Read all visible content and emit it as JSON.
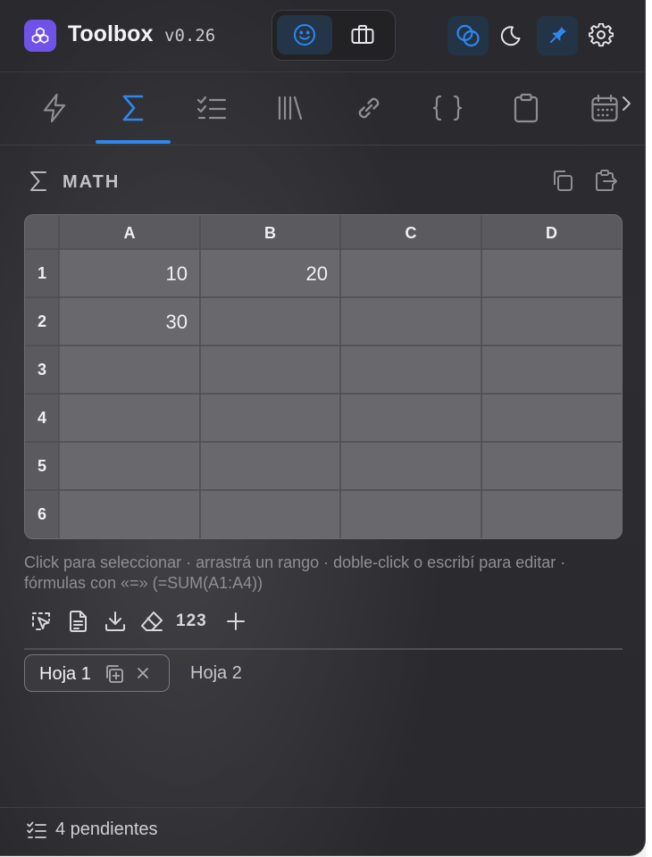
{
  "header": {
    "title": "Toolbox",
    "version": "v0.26",
    "mode_buttons": [
      {
        "icon": "smiley-icon",
        "active": true
      },
      {
        "icon": "briefcase-icon",
        "active": false
      }
    ],
    "actions": [
      {
        "icon": "overlap-circles-icon",
        "active": true
      },
      {
        "icon": "moon-icon",
        "active": false
      },
      {
        "icon": "pin-icon",
        "active": true
      },
      {
        "icon": "gear-icon",
        "active": false
      }
    ]
  },
  "tabs": [
    {
      "icon": "lightning-icon",
      "active": false
    },
    {
      "icon": "sigma-icon",
      "active": true
    },
    {
      "icon": "checklist-icon",
      "active": false
    },
    {
      "icon": "library-icon",
      "active": false
    },
    {
      "icon": "link-icon",
      "active": false
    },
    {
      "icon": "braces-icon",
      "active": false
    },
    {
      "icon": "clipboard-icon",
      "active": false
    },
    {
      "icon": "calendar-icon",
      "active": false
    }
  ],
  "section": {
    "title": "MATH"
  },
  "spreadsheet": {
    "columns": [
      "A",
      "B",
      "C",
      "D"
    ],
    "rows": [
      "1",
      "2",
      "3",
      "4",
      "5",
      "6"
    ],
    "cells": {
      "A1": "10",
      "B1": "20",
      "A2": "30"
    }
  },
  "hint": "Click para seleccionar · arrastrá un rango · doble-click o escribí para editar · fórmulas con «=» (=SUM(A1:A4))",
  "toolbar": {
    "number_format": "123"
  },
  "sheets": {
    "tab1": "Hoja 1",
    "tab2": "Hoja 2"
  },
  "footer": {
    "pending": "4 pendientes"
  },
  "colors": {
    "accent": "#2f87ee",
    "logo": "#6f52e8",
    "background": "#2b2b2f"
  }
}
